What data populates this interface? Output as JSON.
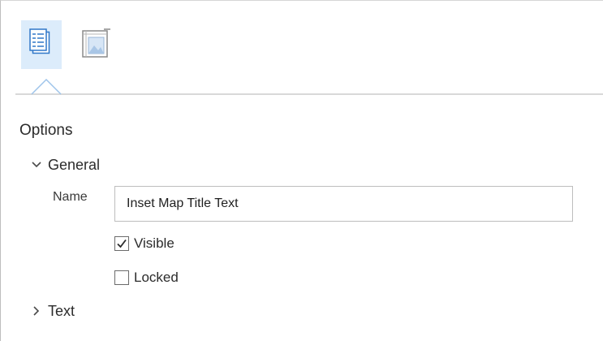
{
  "tabs": [
    {
      "id": "options",
      "icon": "properties-list-icon",
      "selected": true
    },
    {
      "id": "picture",
      "icon": "frame-picture-icon",
      "selected": false
    }
  ],
  "section": {
    "title": "Options"
  },
  "general": {
    "label": "General",
    "expanded": true,
    "name_label": "Name",
    "name_value": "Inset Map Title Text",
    "visible_label": "Visible",
    "visible_checked": true,
    "locked_label": "Locked",
    "locked_checked": false
  },
  "text_group": {
    "label": "Text",
    "expanded": false
  },
  "colors": {
    "selected_tab_bg": "#dcecfb",
    "icon_blue": "#2f77c8",
    "icon_gray": "#8a8a8a",
    "caret": "#9ec4ea"
  }
}
